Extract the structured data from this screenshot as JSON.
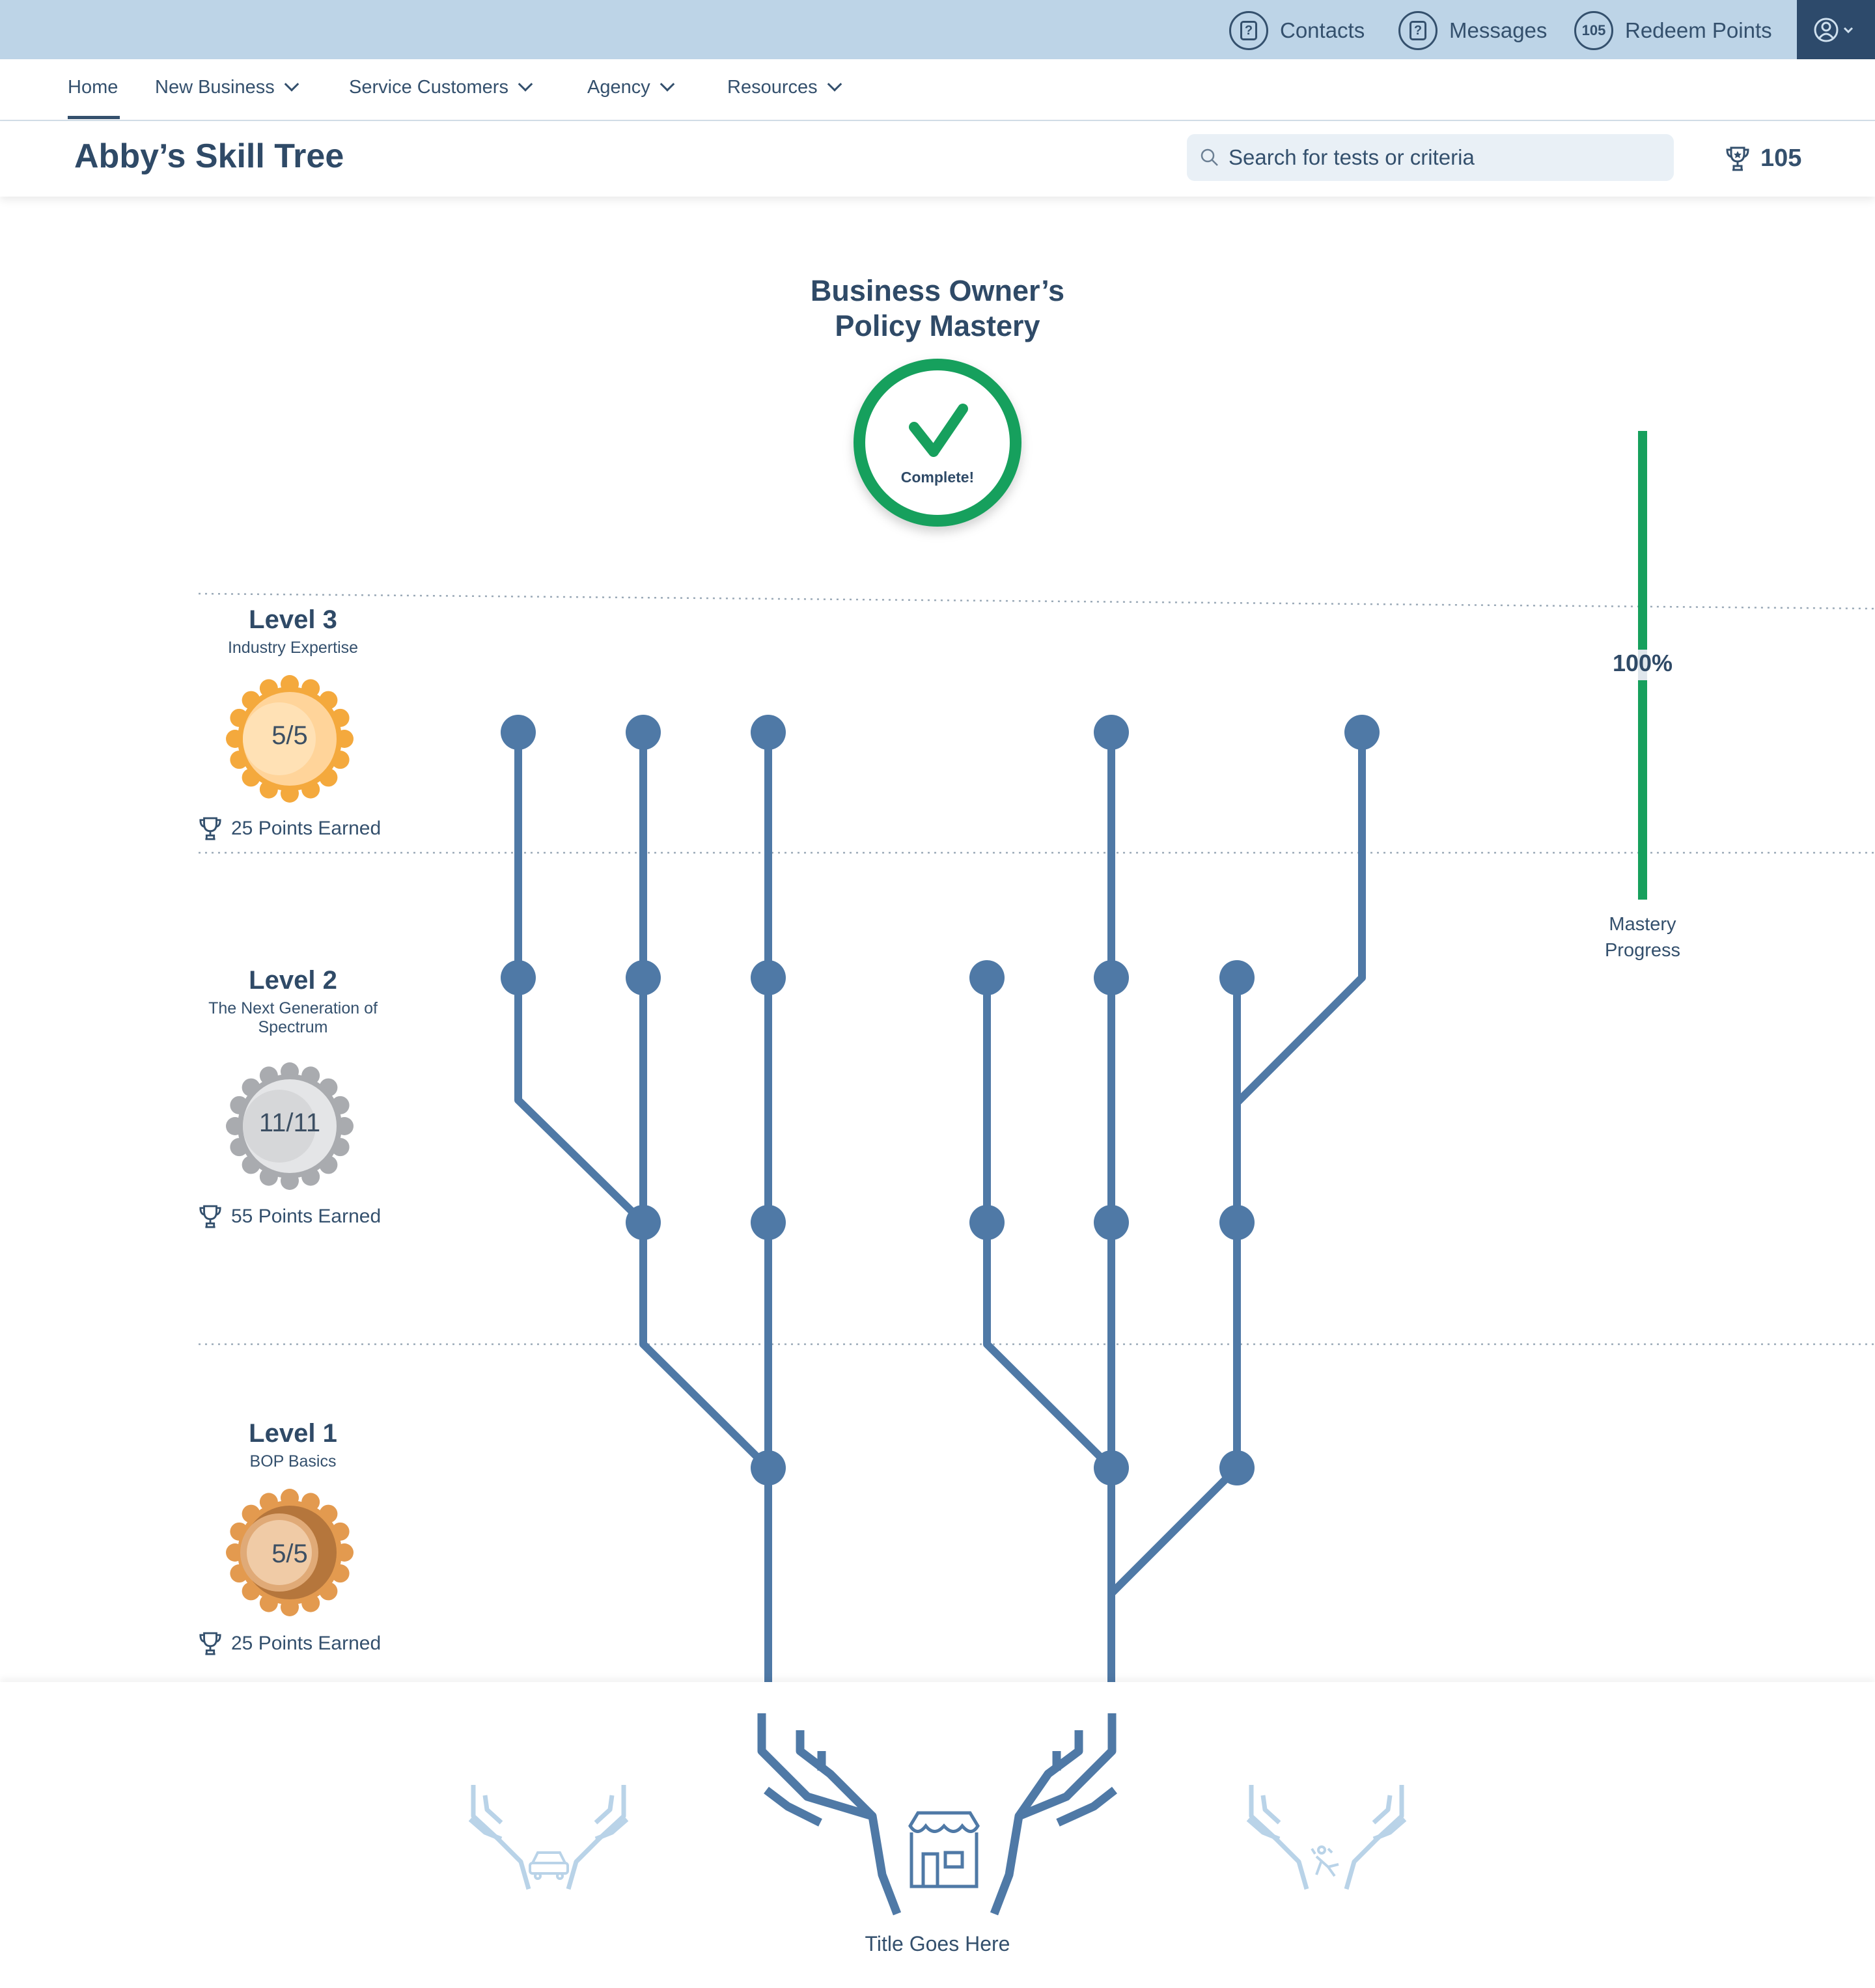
{
  "topbar": {
    "contacts_label": "Contacts",
    "messages_label": "Messages",
    "redeem_badge": "105",
    "redeem_label": "Redeem Points"
  },
  "nav": {
    "tabs": [
      "Home",
      "New Business",
      "Service Customers",
      "Agency",
      "Resources"
    ]
  },
  "header": {
    "title": "Abby’s Skill Tree",
    "search_placeholder": "Search for tests or criteria",
    "points_total": "105"
  },
  "mastery": {
    "title_line1": "Business Owner’s",
    "title_line2": "Policy Mastery",
    "status": "Complete!"
  },
  "levels": [
    {
      "title": "Level 3",
      "subtitle": "Industry Expertise",
      "subtitle2": "",
      "badge": "5/5",
      "earned": "25 Points Earned",
      "tier": "gold"
    },
    {
      "title": "Level 2",
      "subtitle": "The Next Generation  of",
      "subtitle2": "Spectrum",
      "badge": "11/11",
      "earned": "55 Points Earned",
      "tier": "silver"
    },
    {
      "title": "Level 1",
      "subtitle": "BOP Basics",
      "subtitle2": "",
      "badge": "5/5",
      "earned": "25 Points Earned",
      "tier": "bronze"
    }
  ],
  "progress": {
    "value": 100,
    "label_pct": "100%",
    "label_line1": "Mastery",
    "label_line2": "Progress"
  },
  "footer": {
    "title": "Title Goes Here",
    "icons": [
      "car-icon",
      "storefront-icon",
      "injury-icon"
    ]
  },
  "colors": {
    "tree": "#4f79a6",
    "complete": "#17a05d",
    "topbar": "#bdd4e7",
    "text": "#2f4a67",
    "faded_tree": "#b9d3e8"
  }
}
